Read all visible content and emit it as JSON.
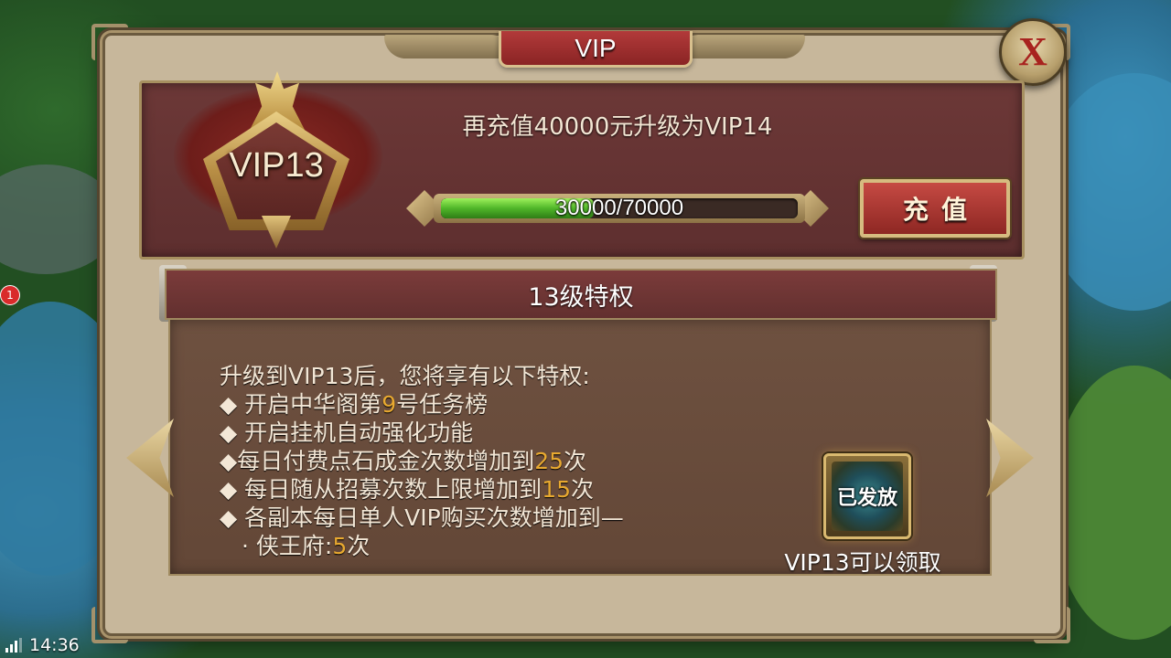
{
  "window": {
    "title": "VIP",
    "close_label": "X"
  },
  "vip_status": {
    "current_level": "VIP13",
    "upgrade_message": "再充值40000元升级为VIP14",
    "progress_text": "30000/70000",
    "progress_fraction": 0.4286,
    "recharge_label": "充值"
  },
  "privileges": {
    "header": "13级特权",
    "intro": "升级到VIP13后，您将享有以下特权:",
    "items": [
      {
        "prefix": "◆ 开启中华阁第",
        "highlight": "9",
        "suffix": "号任务榜"
      },
      {
        "prefix": "◆ 开启挂机自动强化功能",
        "highlight": "",
        "suffix": ""
      },
      {
        "prefix": "◆每日付费点石成金次数增加到",
        "highlight": "25",
        "suffix": "次"
      },
      {
        "prefix": "◆ 每日随从招募次数上限增加到",
        "highlight": "15",
        "suffix": "次"
      },
      {
        "prefix": "◆ 各副本每日单人VIP购买次数增加到—",
        "highlight": "",
        "suffix": ""
      }
    ],
    "sub_item": {
      "prefix": "· 侠王府:",
      "highlight": "5",
      "suffix": "次"
    }
  },
  "reward": {
    "badge": "已发放",
    "caption": "VIP13可以领取"
  },
  "notification_count": "1",
  "status_bar": {
    "time": "14:36"
  }
}
